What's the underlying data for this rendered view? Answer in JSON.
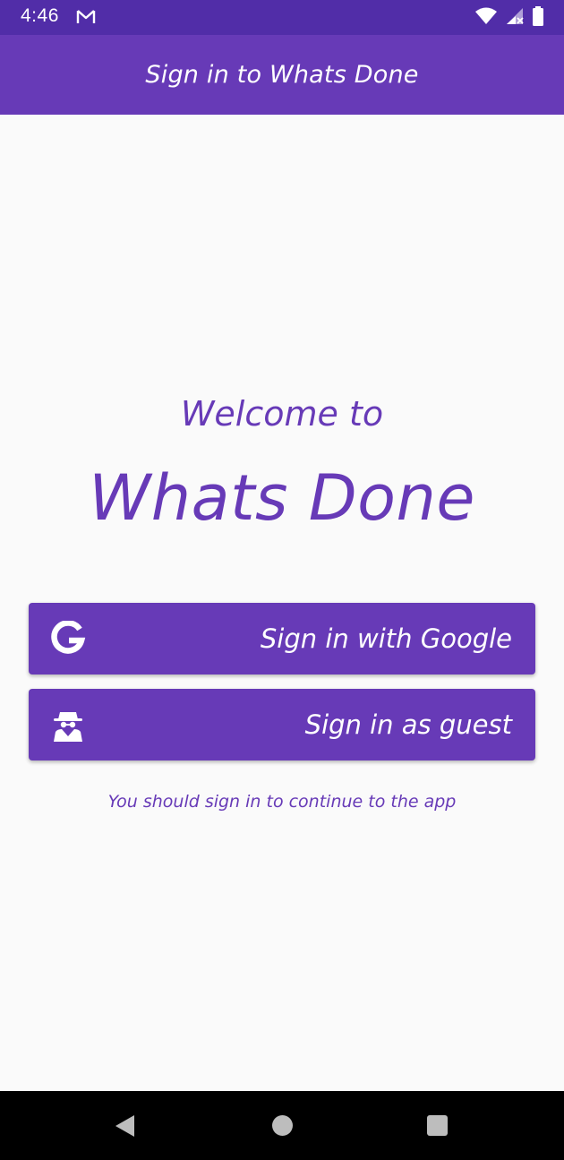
{
  "status_bar": {
    "time": "4:46",
    "notification_icon": "gmail-icon",
    "indicators": [
      "wifi-icon",
      "signal-icon",
      "battery-icon"
    ],
    "background": "#512da8"
  },
  "app_bar": {
    "title": "Sign in to Whats Done",
    "background": "#673ab7"
  },
  "main": {
    "welcome_text": "Welcome to",
    "app_name": "Whats Done",
    "accent_color": "#673ab7",
    "buttons": [
      {
        "label": "Sign in with Google",
        "icon": "google-icon"
      },
      {
        "label": "Sign in as guest",
        "icon": "incognito-icon"
      }
    ],
    "hint": "You should sign in to continue to the app"
  },
  "nav_bar": {
    "buttons": [
      "back-icon",
      "home-icon",
      "recents-icon"
    ]
  }
}
